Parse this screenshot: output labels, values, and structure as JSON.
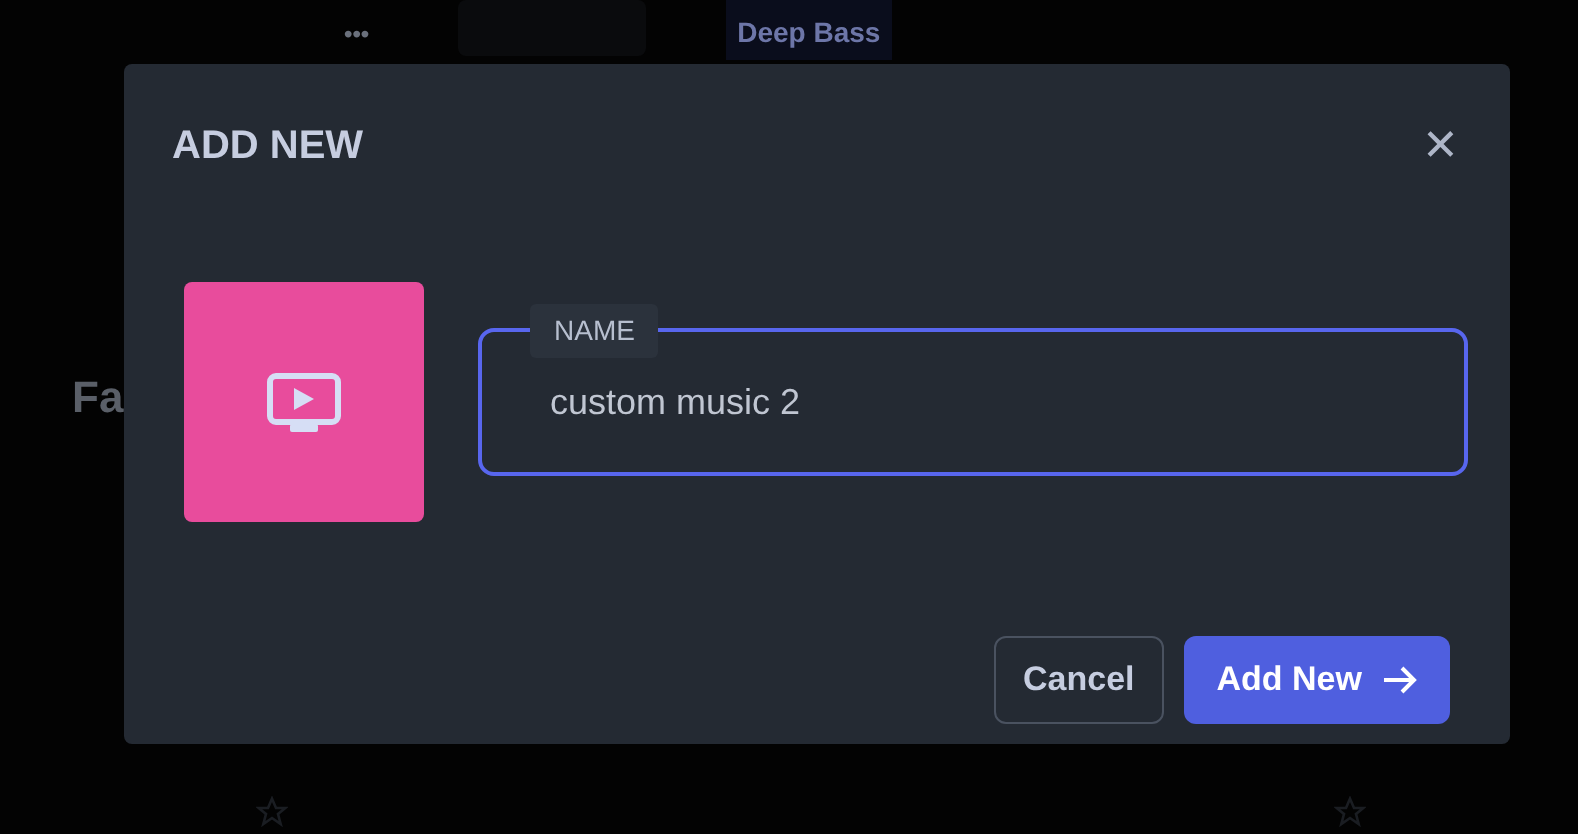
{
  "background": {
    "more_label": "•••",
    "chip": "Deep Bass",
    "heading": "Fa"
  },
  "dialog": {
    "title": "ADD NEW",
    "close": "✕",
    "field": {
      "label": "NAME",
      "value": "custom music 2",
      "focused": true
    },
    "buttons": [
      {
        "label": "Cancel",
        "kind": "secondary"
      },
      {
        "label": "Add New",
        "kind": "primary"
      }
    ]
  }
}
